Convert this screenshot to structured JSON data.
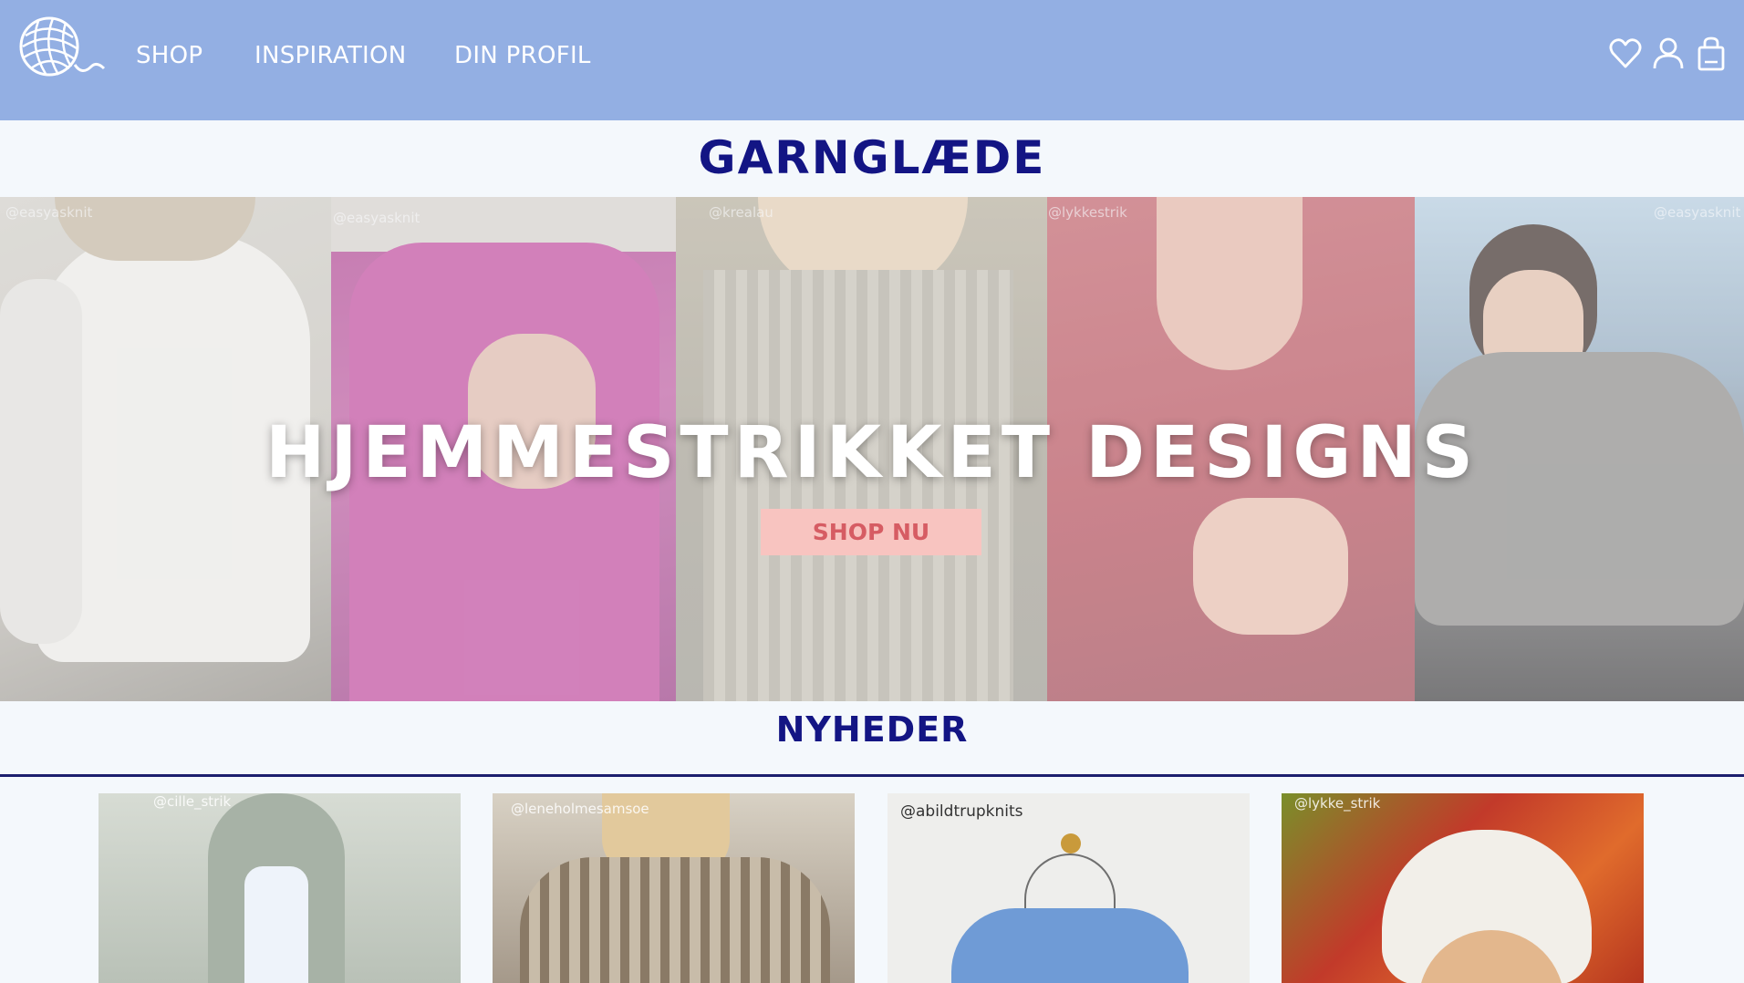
{
  "header": {
    "nav": [
      {
        "label": "SHOP"
      },
      {
        "label": "INSPIRATION"
      },
      {
        "label": "DIN PROFIL"
      }
    ],
    "icons": [
      "yarn-ball-logo",
      "heart-icon",
      "user-icon",
      "shopping-bag-icon"
    ],
    "background_color": "#93afe3"
  },
  "brand": {
    "title": "GARNGLÆDE",
    "color": "#131584"
  },
  "hero": {
    "title": "HJEMMESTRIKKET DESIGNS",
    "cta_label": "SHOP NU",
    "panels": [
      {
        "handle": "@easyasknit"
      },
      {
        "handle": "@easyasknit"
      },
      {
        "handle": "@krealau"
      },
      {
        "handle": "@lykkestrik"
      },
      {
        "handle": "@easyasknit"
      }
    ]
  },
  "news": {
    "title": "NYHEDER",
    "cards": [
      {
        "handle": "@cille_strik"
      },
      {
        "handle": "@leneholmesamsoe"
      },
      {
        "handle": "@abildtrupknits"
      },
      {
        "handle": "@lykke_strik"
      }
    ]
  }
}
